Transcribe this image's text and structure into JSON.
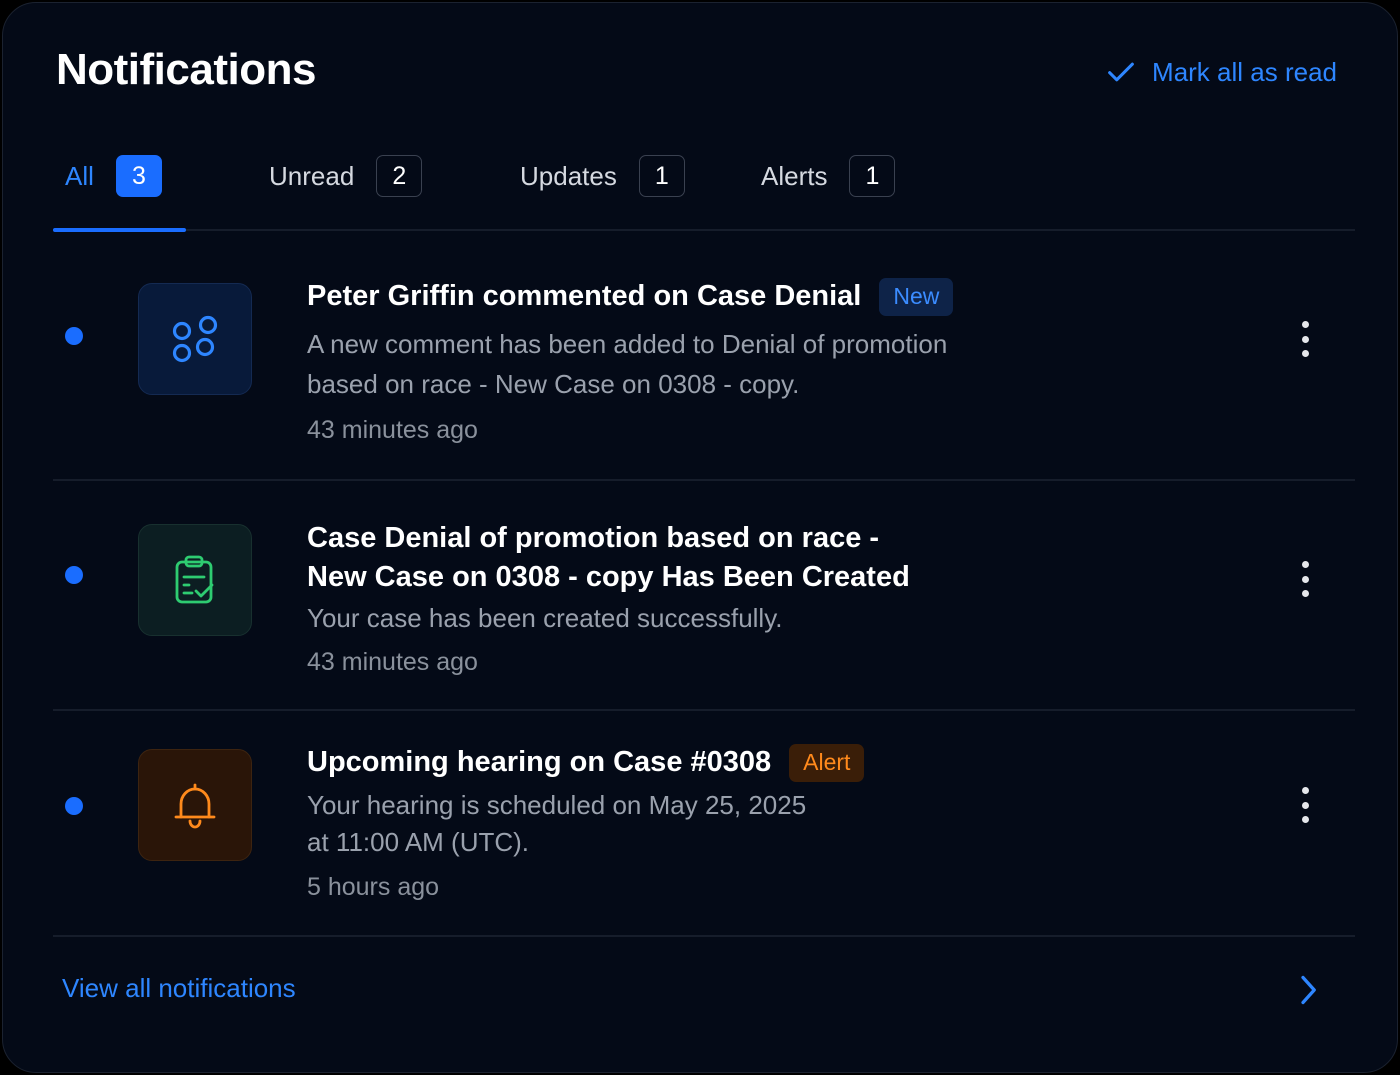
{
  "header": {
    "title": "Notifications",
    "mark_all_label": "Mark all as read"
  },
  "tabs": [
    {
      "label": "All",
      "count": "3",
      "active": true
    },
    {
      "label": "Unread",
      "count": "2",
      "active": false
    },
    {
      "label": "Updates",
      "count": "1",
      "active": false
    },
    {
      "label": "Alerts",
      "count": "1",
      "active": false
    }
  ],
  "notifications": [
    {
      "title": "Peter Griffin commented on Case Denial",
      "badge": "New",
      "body_line1": "A new comment has been added to Denial of promotion",
      "body_line2": "based on race - New Case on 0308 - copy.",
      "time": "43 minutes ago",
      "icon": "comment-nodes-icon",
      "unread": true
    },
    {
      "title_line1": "Case Denial of promotion based on race -",
      "title_line2": "New Case on 0308 - copy Has Been Created",
      "body": "Your case has been created successfully.",
      "time": "43 minutes ago",
      "icon": "clipboard-check-icon",
      "unread": true
    },
    {
      "title": "Upcoming hearing on Case #0308",
      "badge": "Alert",
      "body_line1": "Your hearing is scheduled on May 25, 2025",
      "body_line2": "at 11:00 AM (UTC).",
      "time": "5 hours ago",
      "icon": "bell-icon",
      "unread": true
    }
  ],
  "footer": {
    "view_all_label": "View all notifications"
  },
  "colors": {
    "accent": "#1a6dff",
    "link": "#2e86ff",
    "alert": "#ff8a1c",
    "success": "#2ecc71",
    "panel_bg": "#040a17"
  }
}
